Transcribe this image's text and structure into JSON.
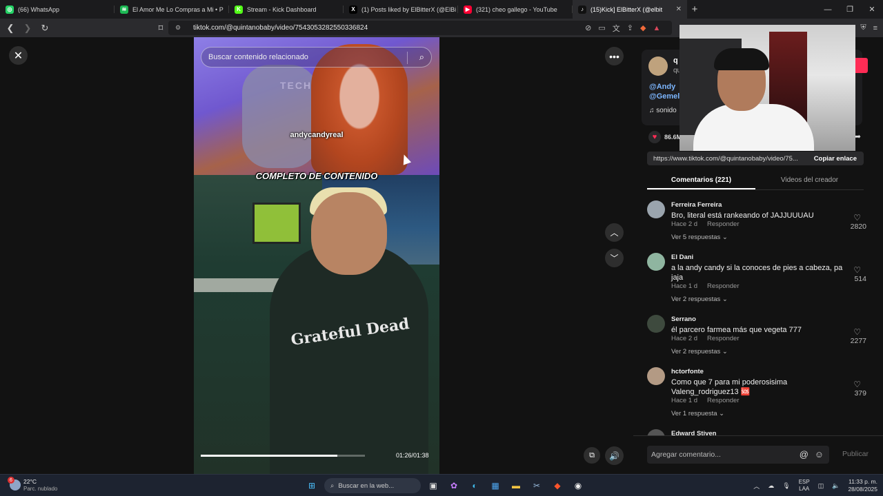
{
  "browser": {
    "tabs": [
      {
        "title": "(66) WhatsApp",
        "icon": "whatsapp-icon",
        "color": "#25d366",
        "glyph": "◎"
      },
      {
        "title": "El Amor Me Lo Compras a Mi • P",
        "icon": "spotify-icon",
        "color": "#1db954",
        "glyph": "≋"
      },
      {
        "title": "Stream - Kick Dashboard",
        "icon": "kick-icon",
        "color": "#53fc18",
        "glyph": "K"
      },
      {
        "title": "(1) Posts liked by ElBitterX (@ElBi",
        "icon": "x-icon",
        "color": "#000000",
        "glyph": "X"
      },
      {
        "title": "(321) cheo gallego - YouTube",
        "icon": "youtube-icon",
        "color": "#ff0033",
        "glyph": "▶"
      },
      {
        "title": "(15)Kick] ElBitterX (@elbit",
        "icon": "tiktok-icon",
        "color": "#111111",
        "glyph": "♪"
      }
    ],
    "url": "tiktok.com/@quintanobaby/video/7543053282550336824"
  },
  "video": {
    "search_placeholder": "Buscar contenido relacionado",
    "caption_top": "andycandyreal",
    "caption_mid": "COMPLETO DE CONTENIDO",
    "shirt_text": "Grateful Dead",
    "overlay_text": "TECHNI",
    "time": "01:26/01:38",
    "progress": 0.83
  },
  "side": {
    "author_name": "q",
    "author_sub": "qu",
    "mentions": [
      "@Andy",
      "@Gemel"
    ],
    "sound": "♫ sonido",
    "likes": "86.6M",
    "link": "https://www.tiktok.com/@quintanobaby/video/75...",
    "copy_label": "Copiar enlace",
    "tab_comments": "Comentarios (221)",
    "tab_videos": "Videos del creador",
    "comments": [
      {
        "name": "Ferreira Ferreira",
        "text": "Bro, literal está rankeando of JAJJUUUAU",
        "time": "Hace 2 d",
        "reply": "Responder",
        "replies": "Ver 5 respuestas ⌄",
        "likes": "2820",
        "avatar": "#9aa4ad"
      },
      {
        "name": "El Dani",
        "text": "a la andy candy si la conoces de pies a cabeza, pa jaja",
        "time": "Hace 1 d",
        "reply": "Responder",
        "replies": "Ver 2 respuestas ⌄",
        "likes": "514",
        "avatar": "#8fb5a0"
      },
      {
        "name": "Serrano",
        "text": "él parcero farmea más que vegeta 777",
        "time": "Hace 2 d",
        "reply": "Responder",
        "replies": "Ver 2 respuestas ⌄",
        "likes": "2277",
        "avatar": "#3e4a3e"
      },
      {
        "name": "hctorfonte",
        "text": "Como que 7 para mi poderosisima Valeng_rodriguez13 🆘",
        "time": "Hace 1 d",
        "reply": "Responder",
        "replies": "Ver 1 respuesta ⌄",
        "likes": "379",
        "avatar": "#b39a84"
      },
      {
        "name": "Edward Stiven",
        "text": "",
        "time": "",
        "reply": "",
        "replies": "",
        "likes": "",
        "avatar": "#555"
      }
    ],
    "comment_placeholder": "Agregar comentario...",
    "publish_label": "Publicar"
  },
  "taskbar": {
    "weather_temp": "22°C",
    "weather_desc": "Parc. nublado",
    "weather_badge": "6",
    "search_placeholder": "Buscar en la web...",
    "lang_1": "ESP",
    "lang_2": "LAA",
    "time": "11:33 p. m.",
    "date": "28/08/2025"
  }
}
